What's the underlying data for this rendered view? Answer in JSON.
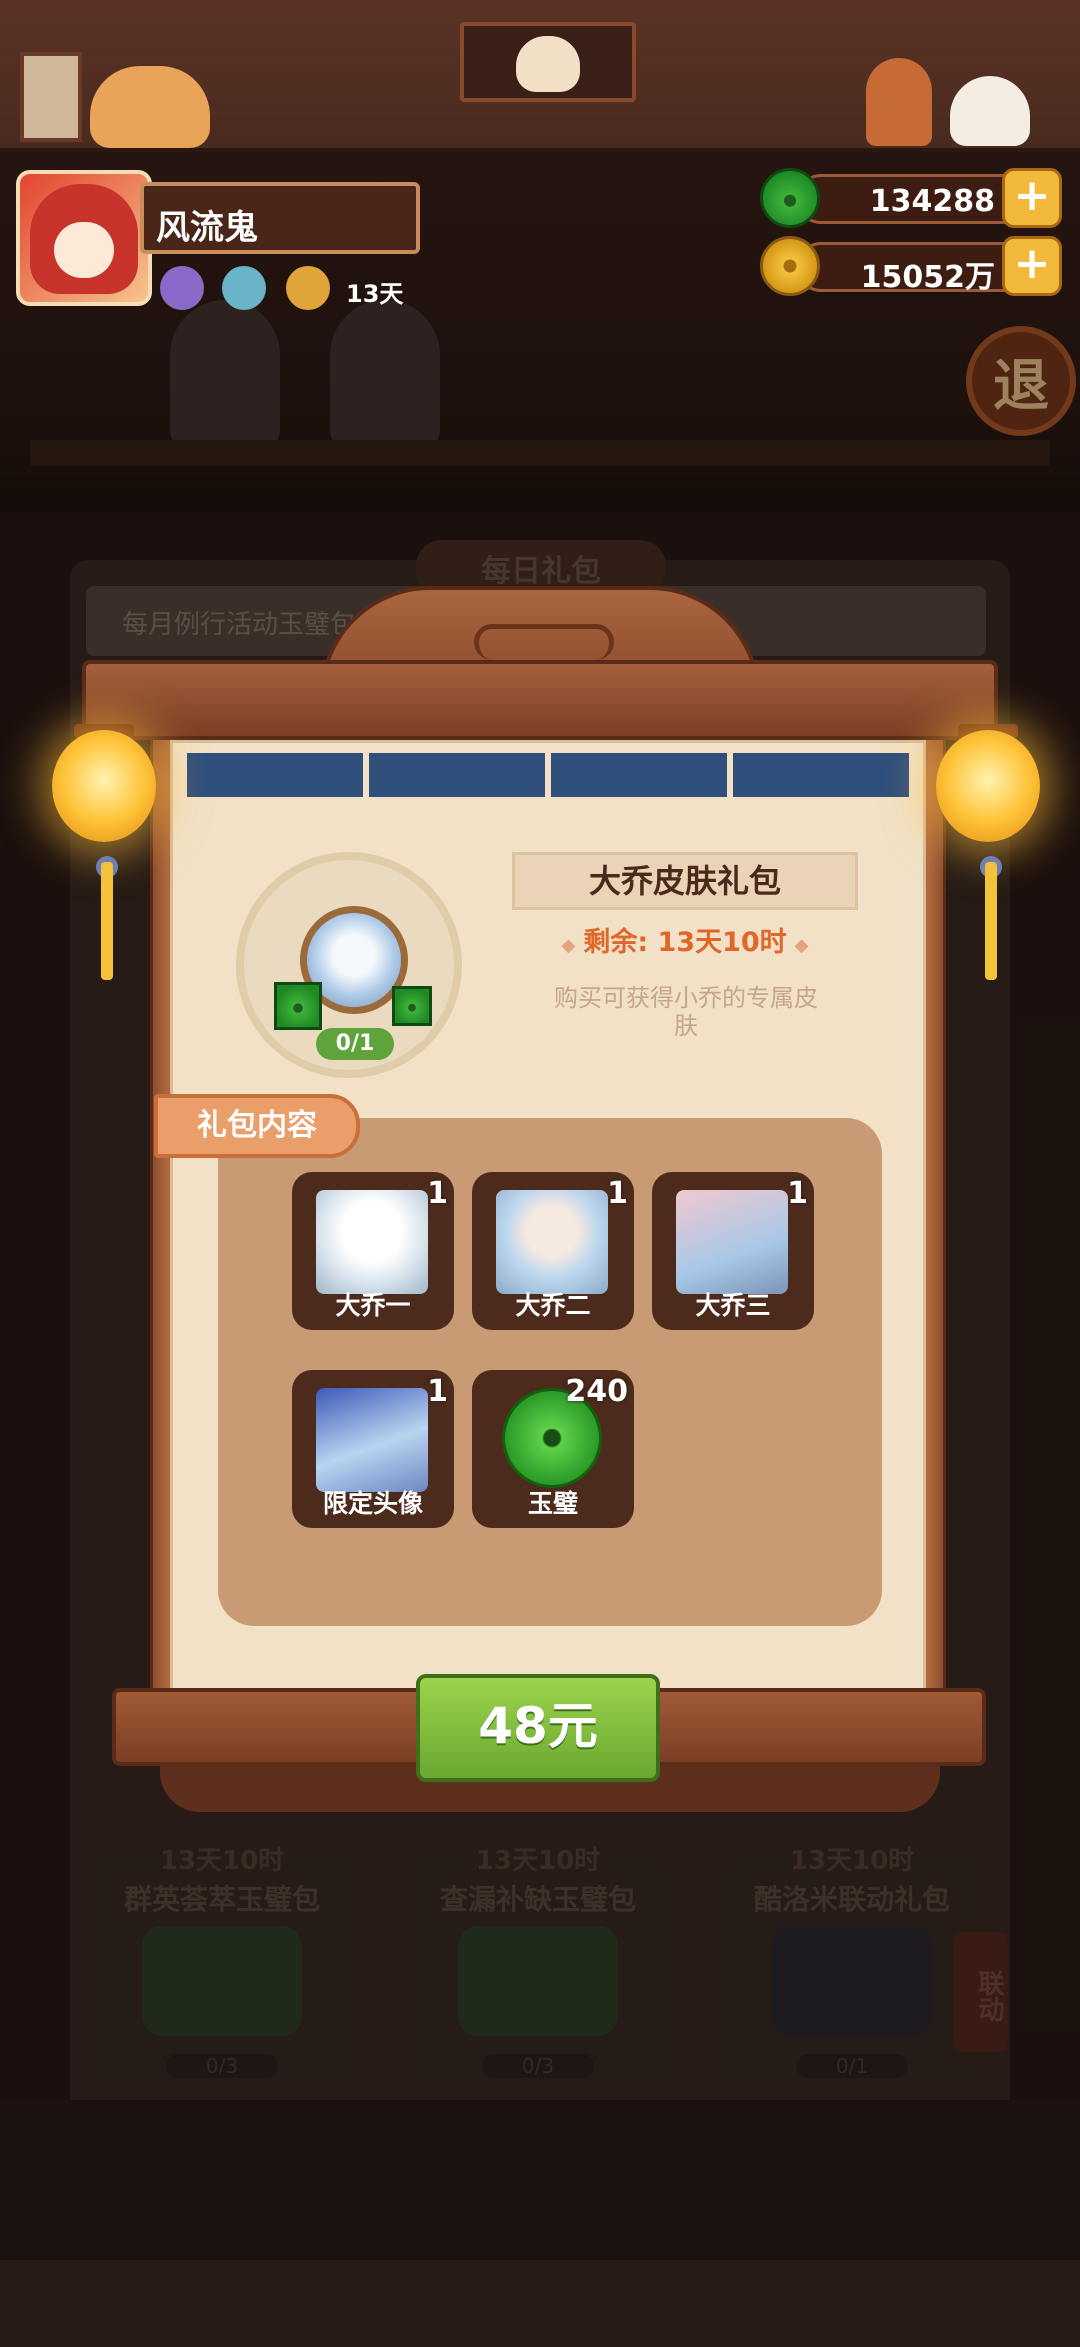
{
  "header": {
    "player_name": "风流鬼",
    "status_days": "13天",
    "jade_amount": "134288",
    "coin_amount": "15052万",
    "plus_label": "+"
  },
  "background": {
    "back_button": "退",
    "tab_label": "每日礼包",
    "banner_text": "每月例行活动玉璧包",
    "cards": [
      {
        "time": "13天10时",
        "title": "群英荟萃玉璧包",
        "progress": "0/3"
      },
      {
        "time": "13天10时",
        "title": "查漏补缺玉璧包",
        "progress": "0/3"
      },
      {
        "time": "13天10时",
        "title": "酷洛米联动礼包",
        "progress": "0/1"
      }
    ],
    "linkage_badge": "联动"
  },
  "gift": {
    "title": "大乔皮肤礼包",
    "remaining": "剩余: 13天10时",
    "description": "购买可获得小乔的专属皮肤",
    "purchase_count": "0/1",
    "contents_label": "礼包内容",
    "items": [
      {
        "label": "大乔一",
        "qty": "1",
        "icon": "skin-icon"
      },
      {
        "label": "大乔二",
        "qty": "1",
        "icon": "skin-icon"
      },
      {
        "label": "大乔三",
        "qty": "1",
        "icon": "skin-icon"
      },
      {
        "label": "限定头像",
        "qty": "1",
        "icon": "avatar-frame-icon"
      },
      {
        "label": "玉璧",
        "qty": "240",
        "icon": "jade-icon"
      }
    ],
    "price": "48元"
  },
  "colors": {
    "accent_orange": "#e0672a",
    "buy_green": "#6aa830",
    "wood": "#7b3f25"
  }
}
